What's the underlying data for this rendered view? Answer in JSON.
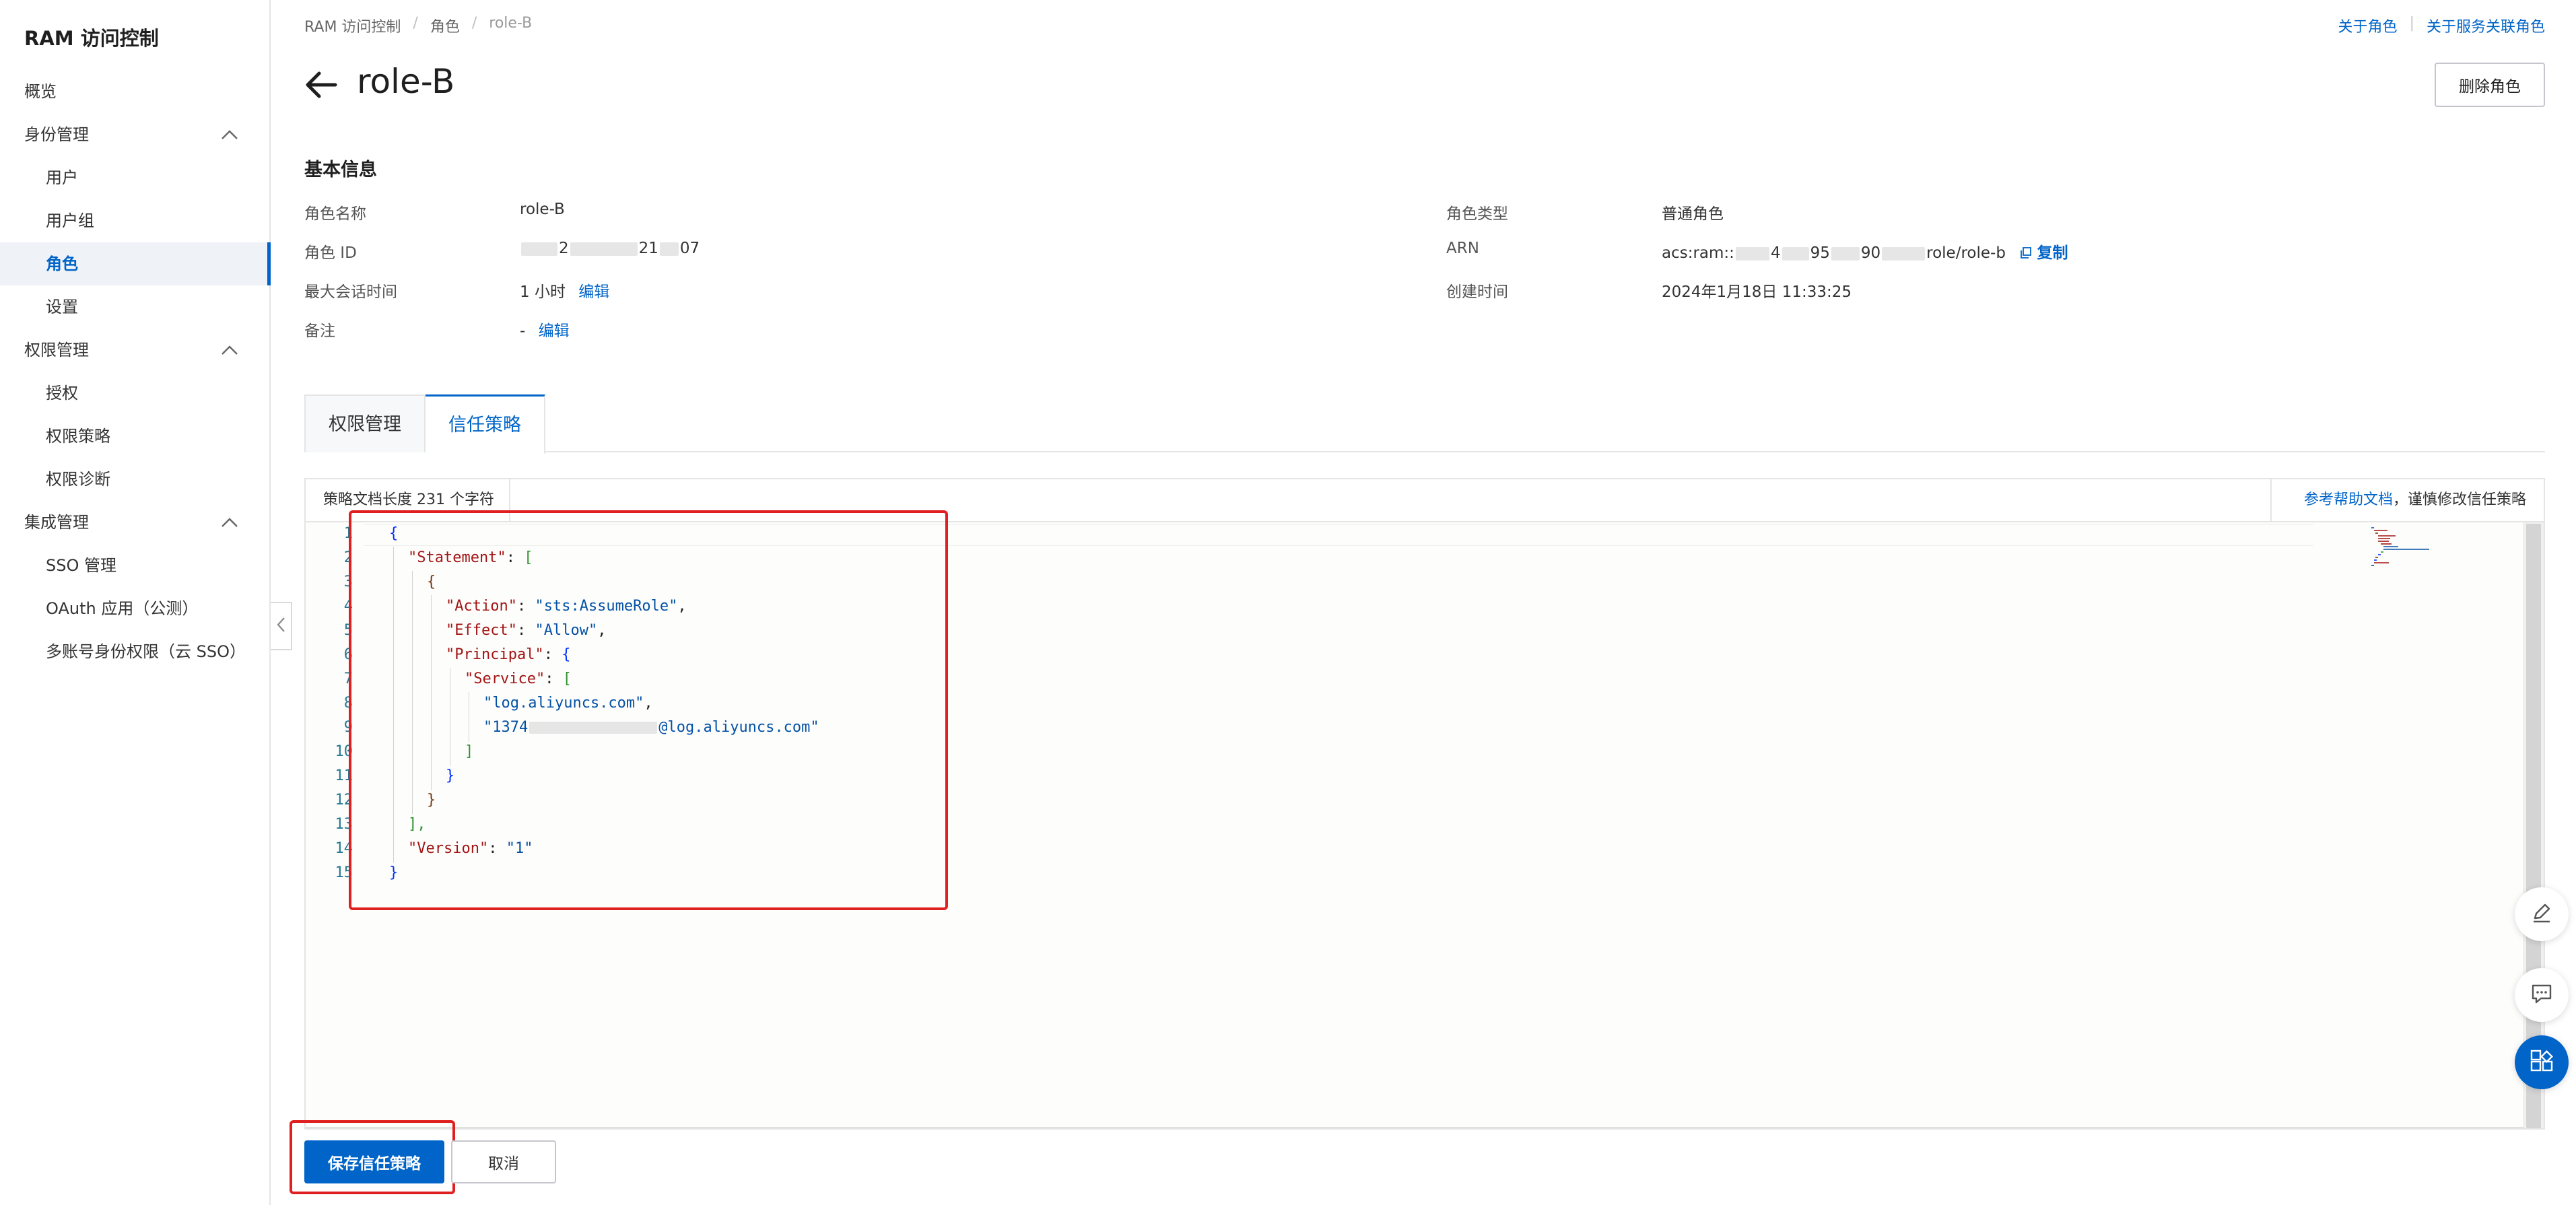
{
  "sidebar": {
    "title": "RAM 访问控制",
    "items": [
      {
        "label": "概览",
        "level": 1
      },
      {
        "label": "身份管理",
        "level": 1,
        "expanded": true
      },
      {
        "label": "用户",
        "level": 2
      },
      {
        "label": "用户组",
        "level": 2
      },
      {
        "label": "角色",
        "level": 2,
        "active": true
      },
      {
        "label": "设置",
        "level": 2
      },
      {
        "label": "权限管理",
        "level": 1,
        "expanded": true
      },
      {
        "label": "授权",
        "level": 2
      },
      {
        "label": "权限策略",
        "level": 2
      },
      {
        "label": "权限诊断",
        "level": 2
      },
      {
        "label": "集成管理",
        "level": 1,
        "expanded": true
      },
      {
        "label": "SSO 管理",
        "level": 2
      },
      {
        "label": "OAuth 应用（公测）",
        "level": 2
      },
      {
        "label": "多账号身份权限（云 SSO）",
        "level": 2
      }
    ]
  },
  "header": {
    "breadcrumb": [
      "RAM 访问控制",
      "角色",
      "role-B"
    ],
    "top_links": [
      "关于角色",
      "关于服务关联角色"
    ],
    "title": "role-B",
    "delete_label": "删除角色"
  },
  "basic_info": {
    "section_title": "基本信息",
    "role_name_label": "角色名称",
    "role_name_value": "role-B",
    "role_id_label": "角色 ID",
    "role_id_visible_1": "2",
    "role_id_visible_2": "21",
    "role_id_visible_3": "07",
    "max_session_label": "最大会话时间",
    "max_session_value": "1 小时",
    "edit_label": "编辑",
    "note_label": "备注",
    "note_value": "-",
    "role_type_label": "角色类型",
    "role_type_value": "普通角色",
    "arn_label": "ARN",
    "arn_prefix": "acs:ram::",
    "arn_part_2": "4",
    "arn_part_3": "95",
    "arn_part_4": "90",
    "arn_suffix": "role/role-b",
    "copy_label": "复制",
    "created_label": "创建时间",
    "created_value": "2024年1月18日 11:33:25"
  },
  "tabs": [
    {
      "label": "权限管理",
      "active": false
    },
    {
      "label": "信任策略",
      "active": true
    }
  ],
  "editor": {
    "doc_length": "策略文档长度 231 个字符",
    "help_link": "参考帮助文档",
    "help_suffix": "，谨慎修改信任策略",
    "line_numbers": [
      "1",
      "2",
      "3",
      "4",
      "5",
      "6",
      "7",
      "8",
      "9",
      "10",
      "11",
      "12",
      "13",
      "14",
      "15"
    ],
    "code": {
      "l1": "{",
      "l2_key": "\"Statement\"",
      "l2_rest": ": ",
      "l2_br": "[",
      "l3": "{",
      "l4_key": "\"Action\"",
      "l4_sep": ": ",
      "l4_val": "\"sts:AssumeRole\"",
      "l4_end": ",",
      "l5_key": "\"Effect\"",
      "l5_sep": ": ",
      "l5_val": "\"Allow\"",
      "l5_end": ",",
      "l6_key": "\"Principal\"",
      "l6_sep": ": ",
      "l6_br": "{",
      "l7_key": "\"Service\"",
      "l7_sep": ": ",
      "l7_br": "[",
      "l8_val": "\"log.aliyuncs.com\"",
      "l8_end": ",",
      "l9_val_start": "\"1374",
      "l9_val_end": "@log.aliyuncs.com\"",
      "l10": "]",
      "l11": "}",
      "l12": "}",
      "l13": "],",
      "l14_key": "\"Version\"",
      "l14_sep": ": ",
      "l14_val": "\"1\"",
      "l15": "}"
    }
  },
  "footer": {
    "save_label": "保存信任策略",
    "cancel_label": "取消"
  },
  "floating": [
    "edit-icon",
    "feedback-icon",
    "apps-icon"
  ],
  "colors": {
    "accent": "#0064c8",
    "highlight": "#e02020"
  }
}
